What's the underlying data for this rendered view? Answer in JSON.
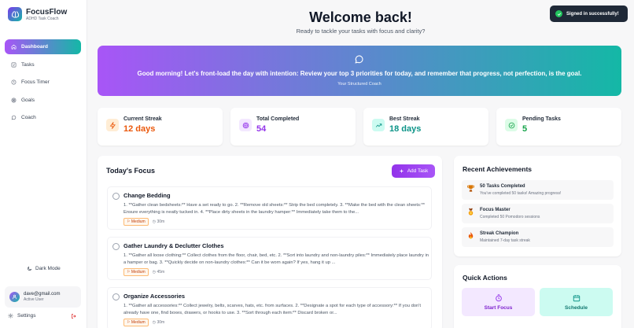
{
  "brand": {
    "name": "FocusFlow",
    "tagline": "ADHD Task Coach"
  },
  "nav": [
    {
      "label": "Dashboard",
      "icon": "home-icon",
      "active": true
    },
    {
      "label": "Tasks",
      "icon": "checklist-icon"
    },
    {
      "label": "Focus Timer",
      "icon": "clock-icon"
    },
    {
      "label": "Goals",
      "icon": "target-icon"
    },
    {
      "label": "Coach",
      "icon": "chat-icon"
    }
  ],
  "sidebar": {
    "dark_mode": "Dark Mode",
    "settings": "Settings"
  },
  "user": {
    "email": "dave@gmail.com",
    "status": "Active User"
  },
  "header": {
    "title": "Welcome back!",
    "subtitle": "Ready to tackle your tasks with focus and clarity?"
  },
  "banner": {
    "message": "Good morning! Let's front-load the day with intention: Review your top 3 priorities for today, and remember that progress, not perfection, is the goal.",
    "signature": "Your Structured Coach"
  },
  "stats": [
    {
      "label": "Current Streak",
      "value": "12 days",
      "icon": "lightning-icon",
      "color": "#ea580c",
      "bg": "#ffedd5"
    },
    {
      "label": "Total Completed",
      "value": "54",
      "icon": "target-icon",
      "color": "#9333ea",
      "bg": "#f3e8ff"
    },
    {
      "label": "Best Streak",
      "value": "18 days",
      "icon": "trend-up-icon",
      "color": "#0d9488",
      "bg": "#ccfbf1"
    },
    {
      "label": "Pending Tasks",
      "value": "5",
      "icon": "check-circle-icon",
      "color": "#16a34a",
      "bg": "#dcfce7"
    }
  ],
  "focus": {
    "title": "Today's Focus",
    "add_label": "Add Task",
    "tasks": [
      {
        "title": "Change Bedding",
        "desc": "1. **Gather clean bedsheets:** Have a set ready to go. 2. **Remove old sheets:** Strip the bed completely. 3. **Make the bed with the clean sheets:** Ensure everything is neatly tucked in. 4. **Place dirty sheets in the laundry hamper:** Immediately take them to the...",
        "priority": "Medium",
        "duration": "30m"
      },
      {
        "title": "Gather Laundry & Declutter Clothes",
        "desc": "1. **Gather all loose clothing:** Collect clothes from the floor, chair, bed, etc. 2. **Sort into laundry and non-laundry piles:** Immediately place laundry in a hamper or bag. 3. **Quickly decide on non-laundry clothes:** Can it be worn again? If yes, hang it up ...",
        "priority": "Medium",
        "duration": "45m"
      },
      {
        "title": "Organize Accessories",
        "desc": "1. **Gather all accessories:** Collect jewelry, belts, scarves, hats, etc. from surfaces. 2. **Designate a spot for each type of accessory:** If you don't already have one, find boxes, drawers, or hooks to use. 3. **Sort through each item:** Discard broken or...",
        "priority": "Medium",
        "duration": "30m"
      }
    ]
  },
  "achievements": {
    "title": "Recent Achievements",
    "items": [
      {
        "name": "50 Tasks Completed",
        "desc": "You've completed 50 tasks! Amazing progress!",
        "icon": "trophy-icon"
      },
      {
        "name": "Focus Master",
        "desc": "Completed 50 Pomodoro sessions",
        "icon": "medal-icon"
      },
      {
        "name": "Streak Champion",
        "desc": "Maintained 7-day task streak",
        "icon": "flame-icon"
      }
    ]
  },
  "quick_actions": {
    "title": "Quick Actions",
    "start_focus": "Start Focus",
    "schedule": "Schedule"
  },
  "toast": {
    "message": "Signed in successfully!"
  }
}
